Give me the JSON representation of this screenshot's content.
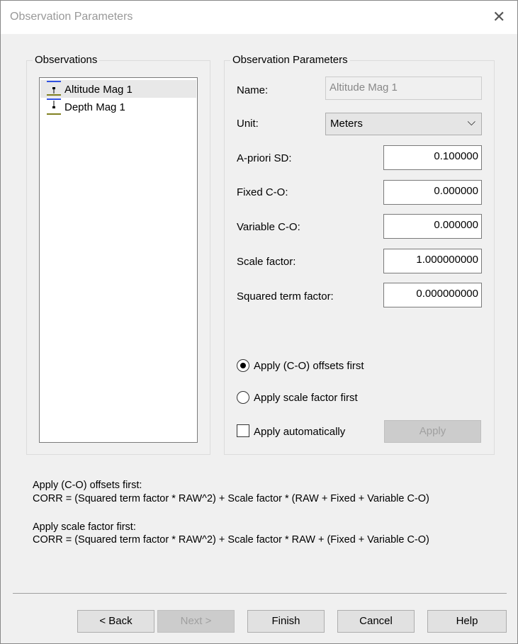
{
  "window": {
    "title": "Observation Parameters",
    "close": "✕"
  },
  "observations": {
    "label": "Observations",
    "items": [
      {
        "label": "Altitude Mag 1",
        "selected": true
      },
      {
        "label": "Depth Mag 1",
        "selected": false
      }
    ]
  },
  "params": {
    "label": "Observation Parameters",
    "name_label": "Name:",
    "name_value": "Altitude Mag 1",
    "unit_label": "Unit:",
    "unit_value": "Meters",
    "apriori_label": "A-priori SD:",
    "apriori_value": "0.100000",
    "fixed_label": "Fixed C-O:",
    "fixed_value": "0.000000",
    "variable_label": "Variable C-O:",
    "variable_value": "0.000000",
    "scale_label": "Scale factor:",
    "scale_value": "1.000000000",
    "squared_label": "Squared term factor:",
    "squared_value": "0.000000000",
    "radio1": "Apply (C-O) offsets first",
    "radio2": "Apply scale factor first",
    "auto": "Apply automatically",
    "apply": "Apply"
  },
  "help": {
    "h1": "Apply (C-O) offsets first:",
    "f1": "CORR = (Squared term factor * RAW^2) + Scale factor * (RAW + Fixed + Variable C-O)",
    "h2": "Apply scale factor first:",
    "f2": "CORR = (Squared term factor * RAW^2) + Scale factor * RAW + (Fixed + Variable C-O)"
  },
  "buttons": {
    "back": "< Back",
    "next": "Next >",
    "finish": "Finish",
    "cancel": "Cancel",
    "help": "Help"
  }
}
